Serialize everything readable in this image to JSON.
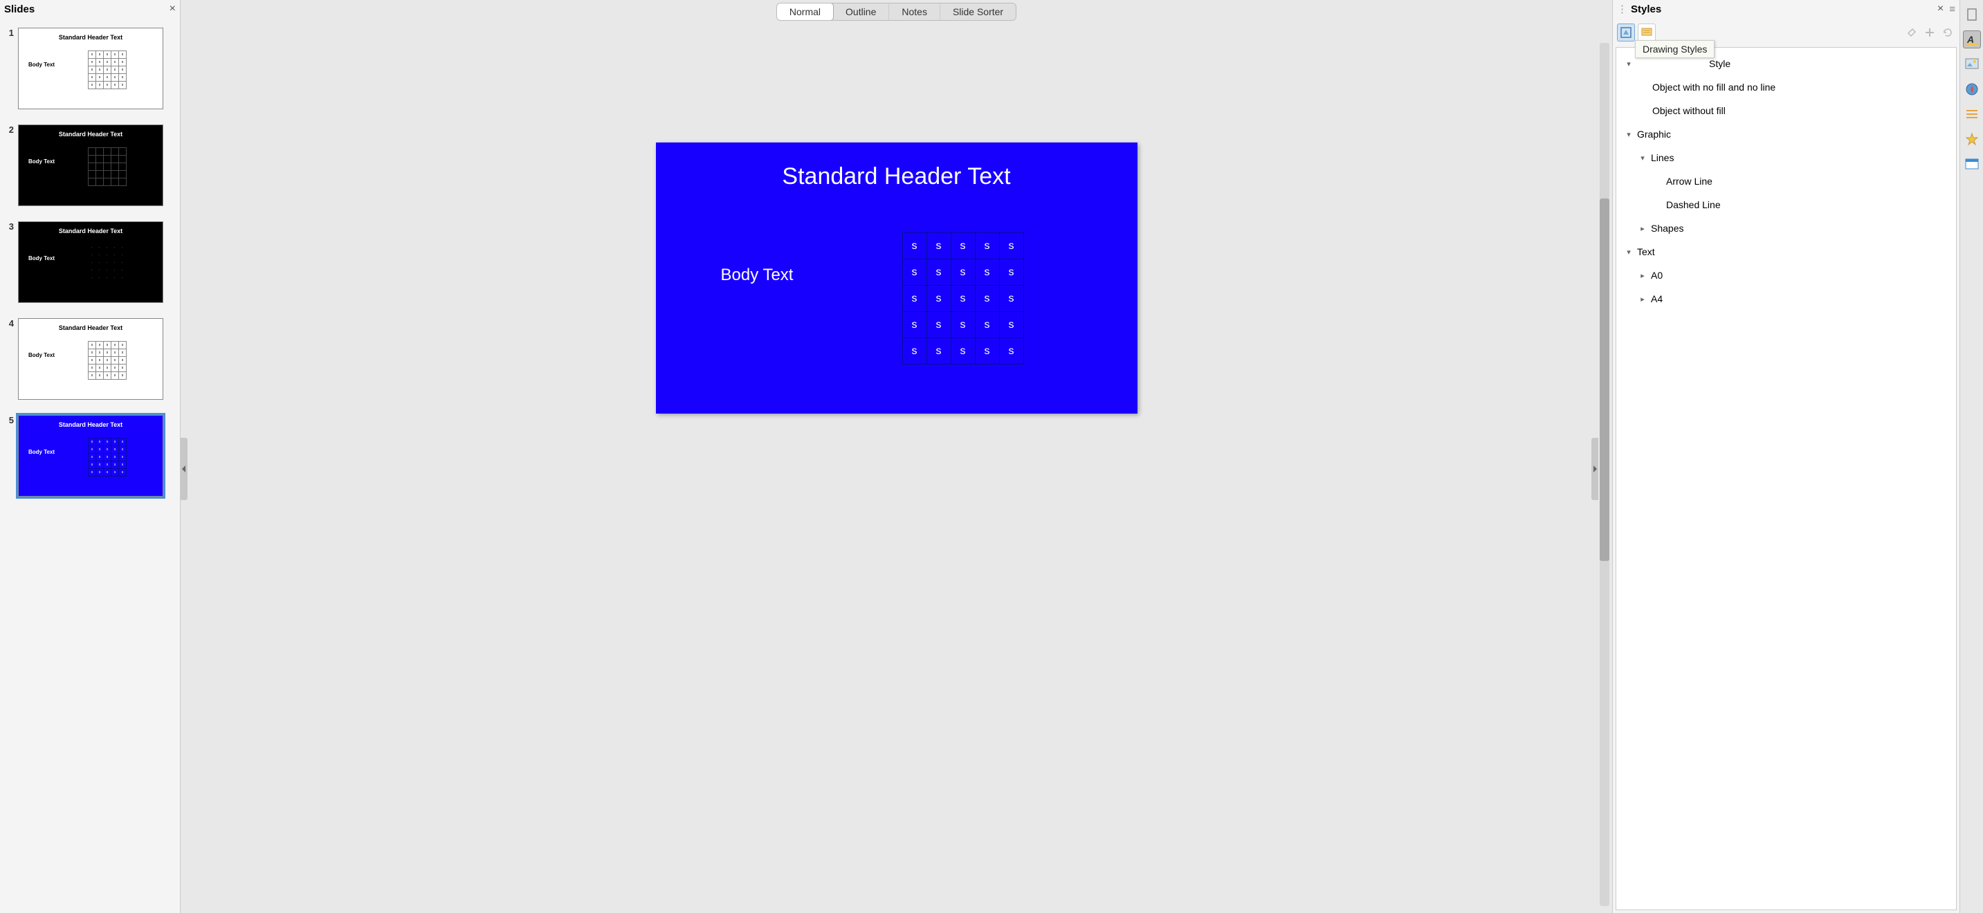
{
  "slide_panel": {
    "title": "Slides",
    "close_label": "×",
    "slides": [
      {
        "num": "1",
        "header": "Standard Header Text",
        "body": "Body Text",
        "bg": "white",
        "cell": "s"
      },
      {
        "num": "2",
        "header": "Standard Header Text",
        "body": "Body Text",
        "bg": "dark",
        "cell": ""
      },
      {
        "num": "3",
        "header": "Standard Header Text",
        "body": "Body Text",
        "bg": "dark-noborder",
        "cell": "·"
      },
      {
        "num": "4",
        "header": "Standard Header Text",
        "body": "Body Text",
        "bg": "white",
        "cell": "s"
      },
      {
        "num": "5",
        "header": "Standard Header Text",
        "body": "Body Text",
        "bg": "blue",
        "cell": "s",
        "selected": true
      }
    ]
  },
  "view_tabs": {
    "normal": "Normal",
    "outline": "Outline",
    "notes": "Notes",
    "slide_sorter": "Slide Sorter"
  },
  "main_slide": {
    "header": "Standard Header Text",
    "body": "Body Text",
    "cell": "s"
  },
  "styles_panel": {
    "title": "Styles",
    "close_label": "×",
    "menu_label": "≡",
    "tooltip": "Drawing Styles",
    "tree": {
      "default_style": "Default Drawing Style",
      "obj_nofill_noline": "Object with no fill and no line",
      "obj_nofill": "Object without fill",
      "graphic": "Graphic",
      "lines": "Lines",
      "arrow_line": "Arrow Line",
      "dashed_line": "Dashed Line",
      "shapes": "Shapes",
      "text": "Text",
      "a0": "A0",
      "a4": "A4"
    }
  }
}
